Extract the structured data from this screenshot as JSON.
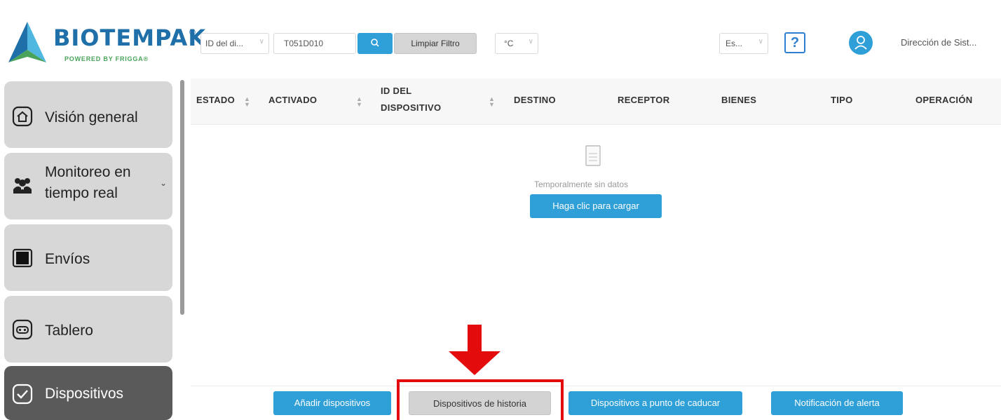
{
  "brand": {
    "name": "BIOTEMPAK",
    "registered": "®",
    "tagline": "POWERED BY FRIGGA®"
  },
  "filters": {
    "field_select": "ID del di...",
    "device_id_value": "T051D010",
    "search_icon": "search-icon",
    "clear_label": "Limpiar Filtro",
    "unit_select": "°C",
    "language_select": "Es...",
    "help_glyph": "?",
    "user_label": "Dirección de Sist..."
  },
  "sidebar": {
    "items": [
      {
        "label": "Visión general",
        "icon": "home-icon"
      },
      {
        "label": "Monitoreo en tiempo real",
        "line1": "Monitoreo en",
        "line2": "tiempo real",
        "icon": "people-icon"
      },
      {
        "label": "Envíos",
        "icon": "box-icon"
      },
      {
        "label": "Tablero",
        "icon": "dashboard-icon"
      },
      {
        "label": "Dispositivos",
        "icon": "check-icon",
        "active": true
      }
    ]
  },
  "table": {
    "columns": [
      {
        "label": "ESTADO",
        "sortable": true
      },
      {
        "label": "ACTIVADO",
        "sortable": true
      },
      {
        "label": "ID DEL",
        "label2": "DISPOSITIVO",
        "sortable": true
      },
      {
        "label": "DESTINO",
        "sortable": false
      },
      {
        "label": "RECEPTOR",
        "sortable": false
      },
      {
        "label": "BIENES",
        "sortable": false
      },
      {
        "label": "TIPO",
        "sortable": false
      },
      {
        "label": "OPERACIÓN",
        "sortable": false
      }
    ],
    "empty_text": "Temporalmente sin datos",
    "load_button": "Haga clic para cargar"
  },
  "actions": {
    "add": "Añadir dispositivos",
    "history": "Dispositivos de historia",
    "expiring": "Dispositivos a punto de caducar",
    "alert": "Notificación de alerta"
  },
  "colors": {
    "accent": "#2f9fd8",
    "highlight": "#e30b0b",
    "active_nav": "#5a5a5a",
    "nav": "#d7d7d7"
  }
}
